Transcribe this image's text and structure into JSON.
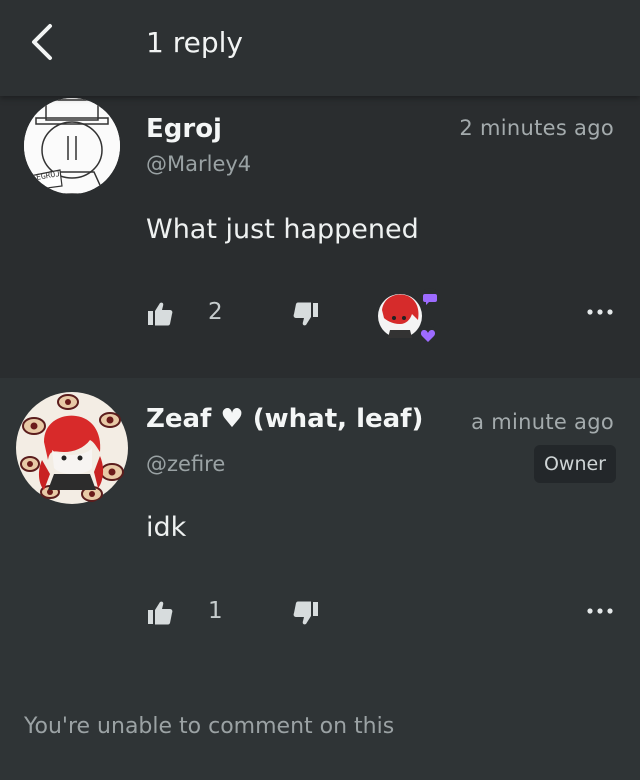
{
  "header": {
    "title": "1 reply"
  },
  "comments": [
    {
      "author": "Egroj",
      "handle": "@Marley4",
      "time": "2 minutes ago",
      "text": "What just happened",
      "likes": "2",
      "avatar_scribble": "EGROJ"
    },
    {
      "author": "Zeaf ♥ (what, leaf)",
      "handle": "@zefire",
      "time": "a minute ago",
      "badge": "Owner",
      "text": "idk",
      "likes": "1"
    }
  ],
  "footer": {
    "text": "You're unable to comment on this"
  },
  "colors": {
    "background": "#242729",
    "header": "#2d3133",
    "reaction_purple": "#9d6bff"
  },
  "icons": [
    "back-arrow-icon",
    "thumbs-up-icon",
    "thumbs-down-icon",
    "more-options-icon",
    "message-icon",
    "heart-icon"
  ]
}
